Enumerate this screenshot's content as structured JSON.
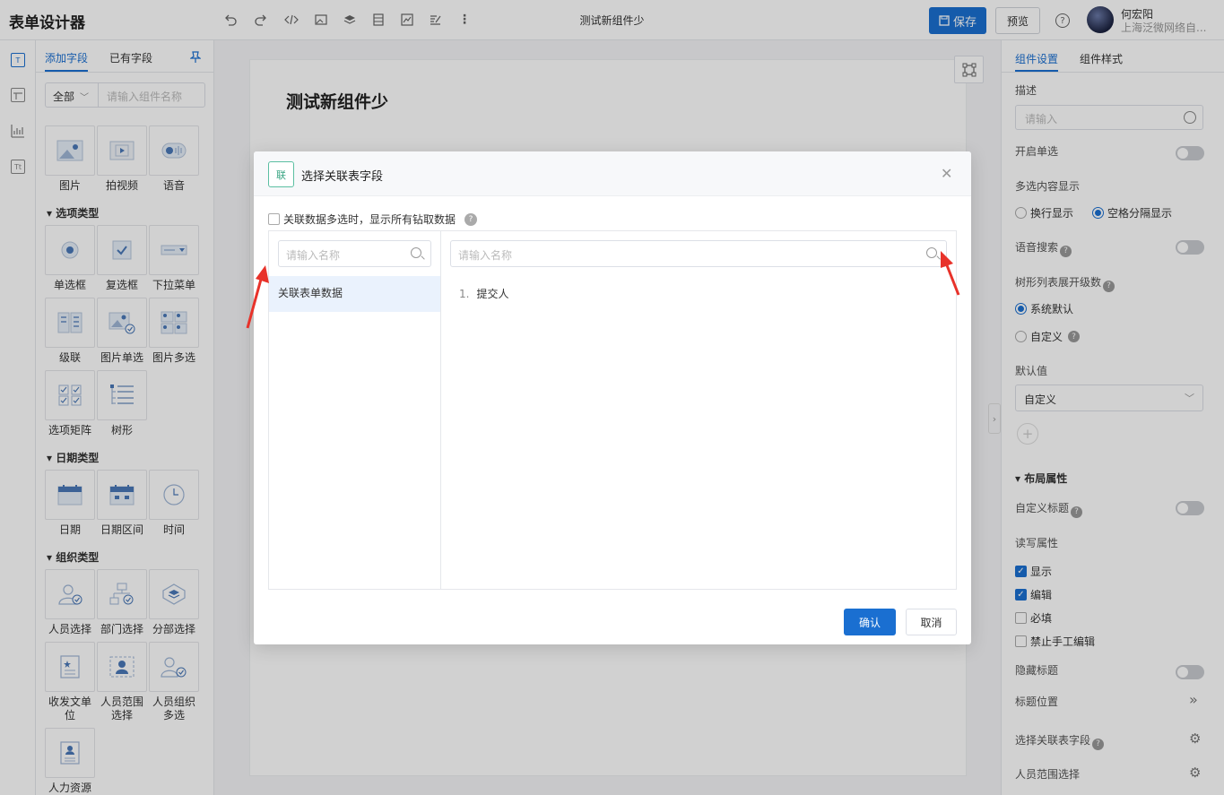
{
  "app": {
    "title": "表单设计器",
    "document_title": "测试新组件少"
  },
  "toolbar": {
    "icons": [
      "undo-icon",
      "redo-icon",
      "code-icon",
      "image-icon",
      "layers-icon",
      "database-icon",
      "chart-icon",
      "edit-icon",
      "more-icon"
    ],
    "save_label": "保存",
    "preview_label": "预览",
    "help_label": "?"
  },
  "user": {
    "name": "何宏阳",
    "org": "上海泛微网络自..."
  },
  "left_panel": {
    "tabs": [
      "添加字段",
      "已有字段"
    ],
    "filter_label": "全部",
    "search_placeholder": "请输入组件名称",
    "sections": [
      {
        "title": "",
        "items": [
          "图片",
          "拍视频",
          "语音"
        ]
      },
      {
        "title": "选项类型",
        "items": [
          "单选框",
          "复选框",
          "下拉菜单",
          "级联",
          "图片单选",
          "图片多选",
          "选项矩阵",
          "树形"
        ]
      },
      {
        "title": "日期类型",
        "items": [
          "日期",
          "日期区间",
          "时间"
        ]
      },
      {
        "title": "组织类型",
        "items": [
          "人员选择",
          "部门选择",
          "分部选择",
          "收发文单位",
          "人员范围选择",
          "人员组织多选",
          "人力资源"
        ]
      }
    ]
  },
  "canvas": {
    "form_title": "测试新组件少"
  },
  "right_panel": {
    "tabs": [
      "组件设置",
      "组件样式"
    ],
    "desc_label": "描述",
    "desc_placeholder": "请输入",
    "single_select_label": "开启单选",
    "multi_display_label": "多选内容显示",
    "multi_display_options": [
      "换行显示",
      "空格分隔显示"
    ],
    "voice_search_label": "语音搜索",
    "tree_levels_label": "树形列表展开级数",
    "tree_levels_options": [
      "系统默认",
      "自定义"
    ],
    "default_value_label": "默认值",
    "default_value_selected": "自定义",
    "layout_section": "布局属性",
    "custom_title_label": "自定义标题",
    "rw_label": "读写属性",
    "rw_options": [
      {
        "label": "显示",
        "checked": true
      },
      {
        "label": "编辑",
        "checked": true
      },
      {
        "label": "必填",
        "checked": false
      },
      {
        "label": "禁止手工编辑",
        "checked": false
      }
    ],
    "hide_title_label": "隐藏标题",
    "title_position_label": "标题位置",
    "select_field_label": "选择关联表字段",
    "person_range_label": "人员范围选择"
  },
  "modal": {
    "title": "选择关联表字段",
    "logo_text": "联",
    "checkbox_label": "关联数据多选时，显示所有钻取数据",
    "left_search_placeholder": "请输入名称",
    "right_search_placeholder": "请输入名称",
    "left_items": [
      "关联表单数据"
    ],
    "right_items": [
      {
        "num": "1.",
        "label": "提交人"
      }
    ],
    "confirm_label": "确认",
    "cancel_label": "取消"
  },
  "colors": {
    "primary": "#1a6fd1",
    "annotation_arrow": "#e8322a",
    "selected_row": "#eaf2fd"
  }
}
